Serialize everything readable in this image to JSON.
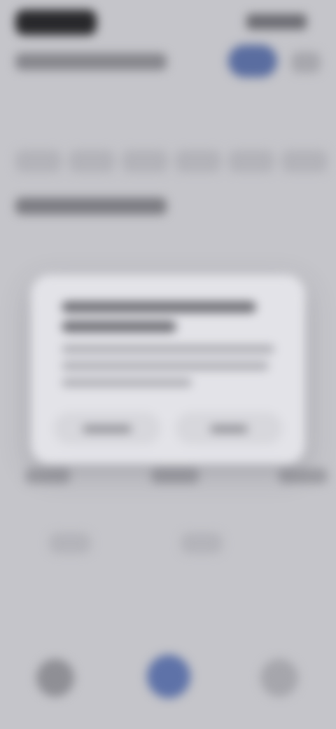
{
  "status_bar": {
    "time": "",
    "battery": ""
  },
  "header": {
    "title": "",
    "action_pill": "",
    "more_icon": "more-icon"
  },
  "dates": [
    "",
    "",
    "",
    "",
    "",
    ""
  ],
  "section": {
    "title": ""
  },
  "dialog": {
    "title_line_1": "",
    "title_line_2": "",
    "body_line_1": "",
    "body_line_2": "",
    "body_line_3": "",
    "secondary_button": "",
    "primary_button": ""
  },
  "bottom_nav": {
    "home": "",
    "center": "",
    "profile": ""
  },
  "colors": {
    "background": "#c5c5ca",
    "accent": "#5a6da0",
    "dialog_bg": "#e3e3e8"
  }
}
